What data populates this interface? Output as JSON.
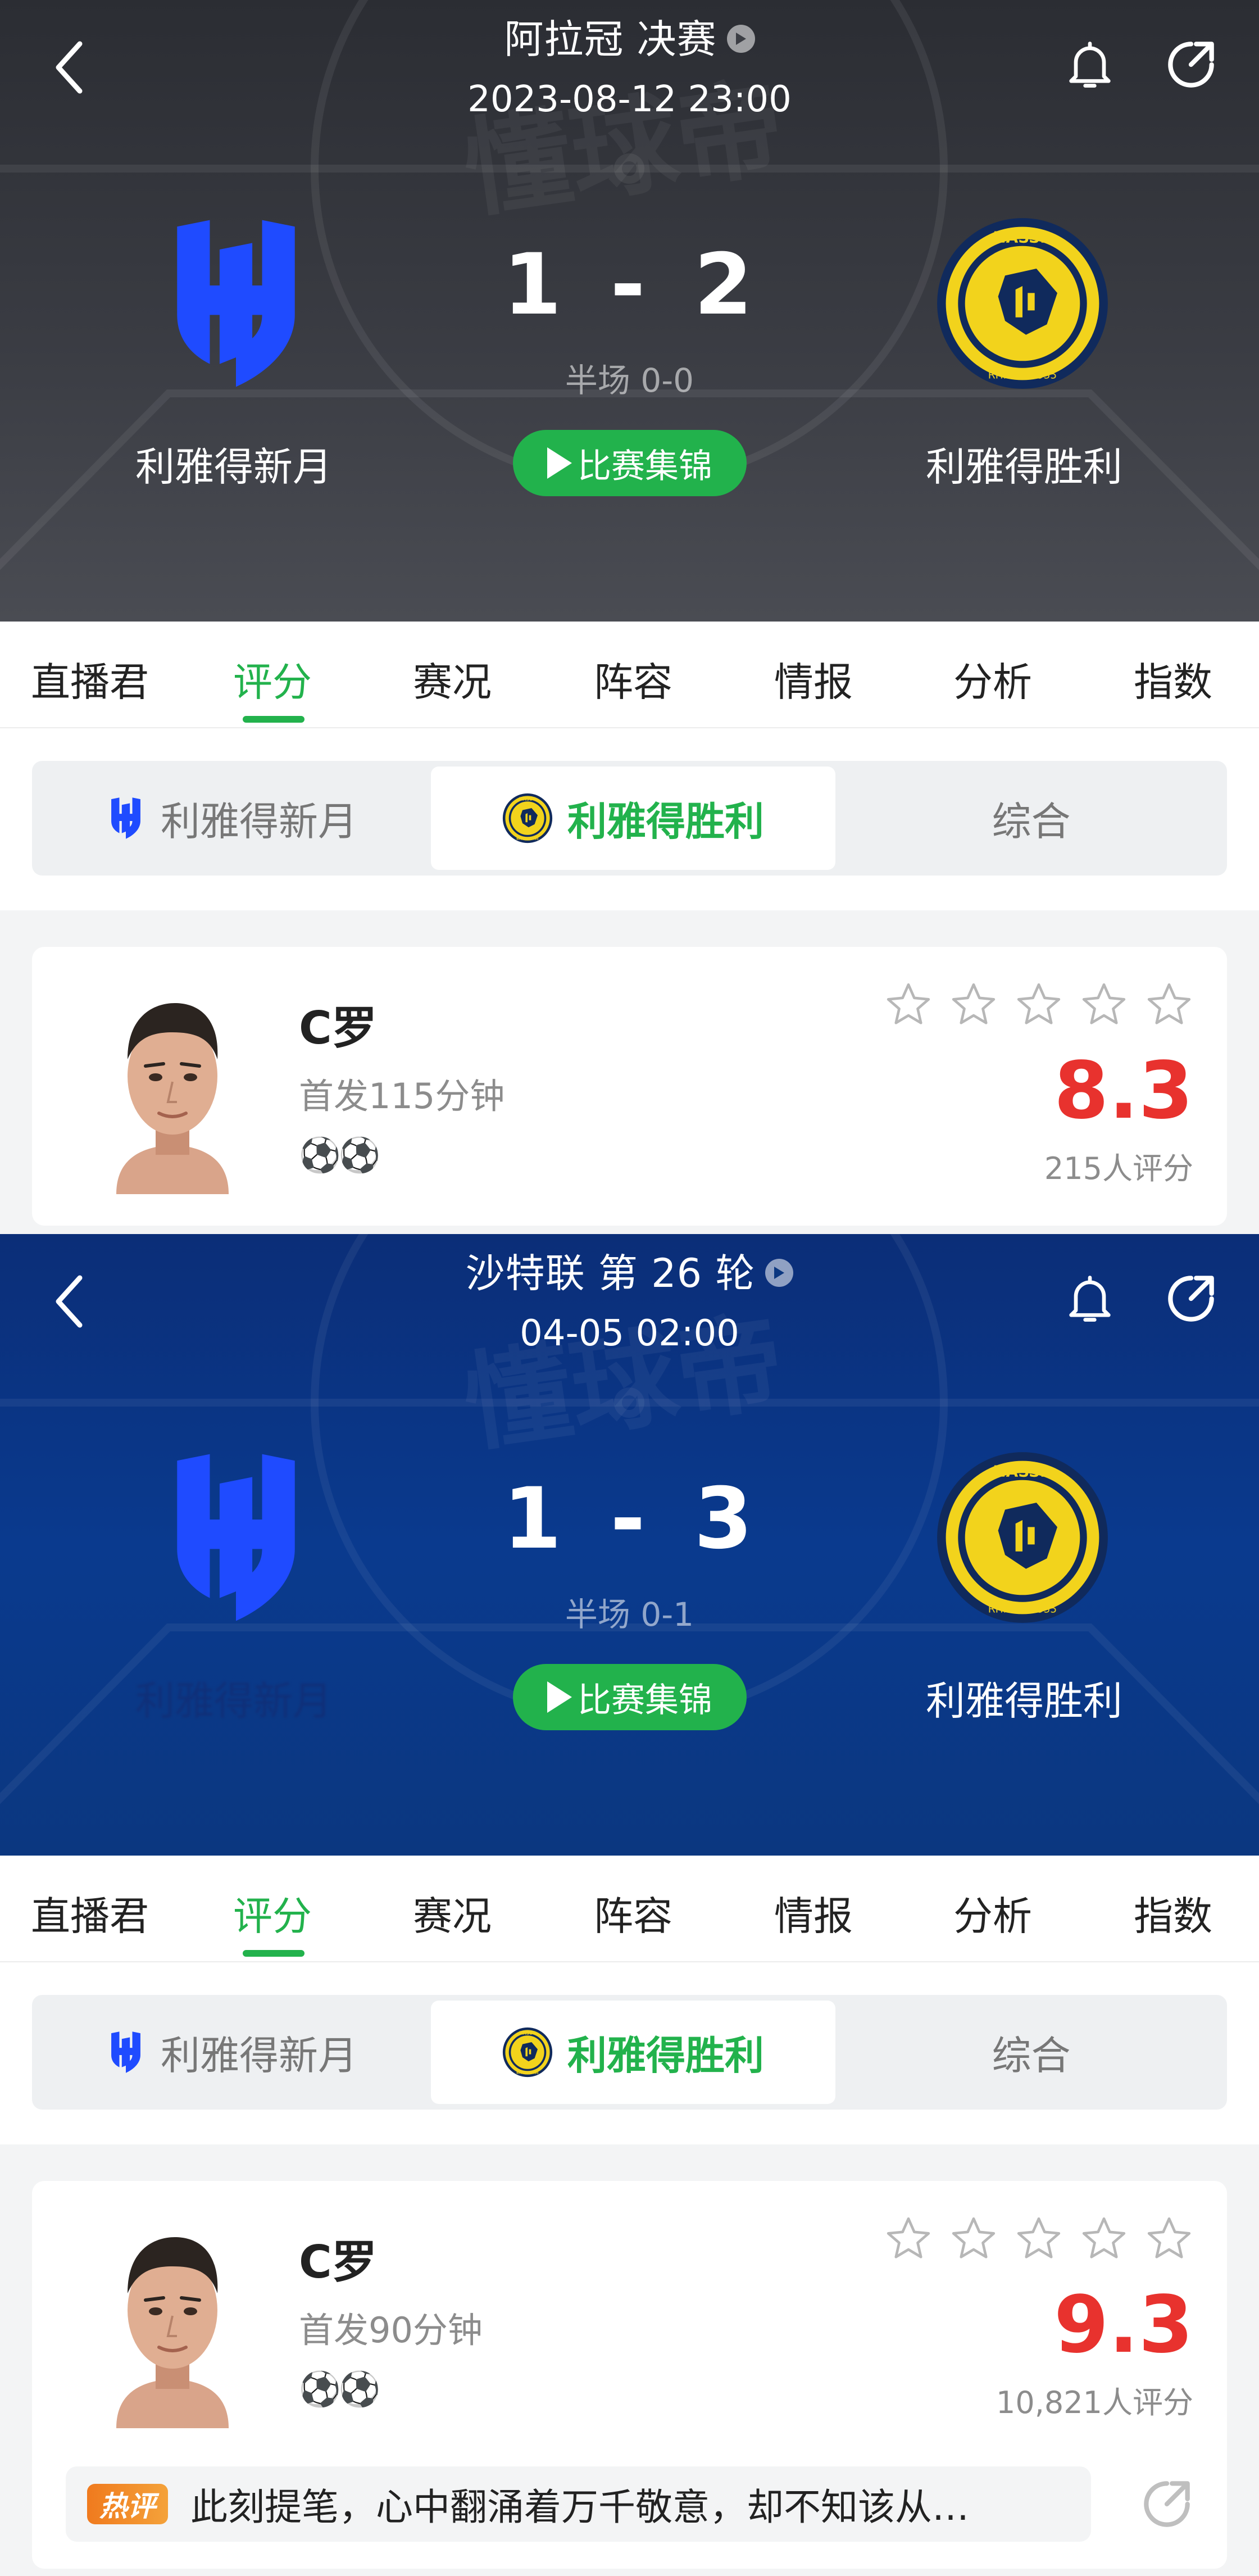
{
  "tabs": [
    "直播君",
    "评分",
    "赛况",
    "阵容",
    "情报",
    "分析",
    "指数"
  ],
  "segment": {
    "home": "利雅得新月",
    "away": "利雅得胜利",
    "overall": "综合"
  },
  "highlight_label": "比赛集锦",
  "colors": {
    "accent_green": "#22b24c",
    "rating_red": "#e8322e",
    "header1_bg": "#3a3c43",
    "header2_bg": "#0b3780",
    "home_blue": "#1f4bff",
    "nassr_yellow": "#f2d31c",
    "nassr_navy": "#102a5c"
  },
  "screens": [
    {
      "league": "阿拉冠 决赛",
      "datetime": "2023-08-12 23:00",
      "home_name": "利雅得新月",
      "away_name": "利雅得胜利",
      "home_score": "1",
      "dash": "-",
      "away_score": "2",
      "halftime": "半场 0-0",
      "player": {
        "name": "C罗",
        "minutes": "首发115分钟",
        "goals": "⚽⚽",
        "rating": "8.3",
        "votes": "215人评分",
        "stars_filled": 0
      }
    },
    {
      "league": "沙特联 第 26 轮",
      "datetime": "04-05 02:00",
      "home_name": "利雅得新月",
      "away_name": "利雅得胜利",
      "home_score": "1",
      "dash": "-",
      "away_score": "3",
      "halftime": "半场 0-1",
      "player": {
        "name": "C罗",
        "minutes": "首发90分钟",
        "goals": "⚽⚽",
        "rating": "9.3",
        "votes": "10,821人评分",
        "stars_filled": 0
      },
      "comment": {
        "badge": "热评",
        "text": "此刻提笔，心中翻涌着万千敬意，却不知该从…"
      }
    }
  ]
}
